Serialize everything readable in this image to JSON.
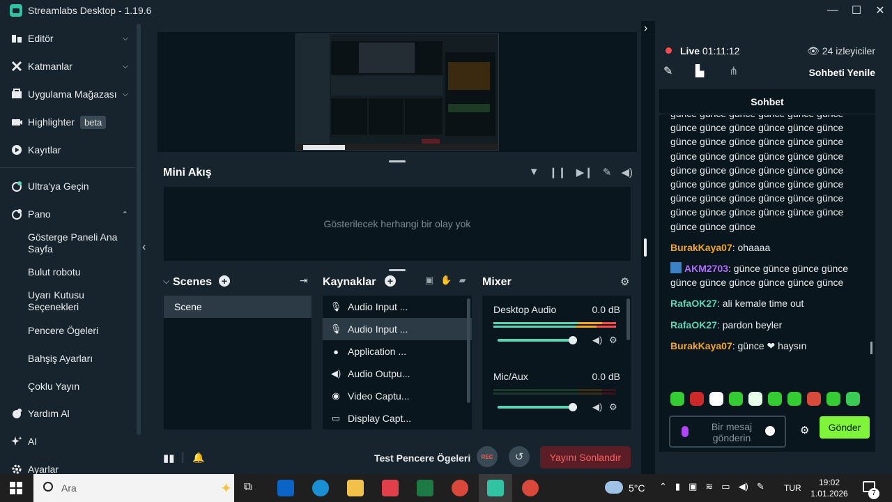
{
  "window": {
    "title": "Streamlabs Desktop - 1.19.6",
    "minimize": "—",
    "maximize": "☐",
    "close": "✕"
  },
  "sidebar": {
    "items": [
      {
        "label": "Editör",
        "icon": "editor-icon",
        "chevron": "⌵"
      },
      {
        "label": "Katmanlar",
        "icon": "layers-icon",
        "chevron": "⌵"
      },
      {
        "label": "Uygulama Mağazası",
        "icon": "store-icon",
        "chevron": "⌵"
      },
      {
        "label": "Highlighter",
        "icon": "highlighter-icon",
        "badge": "beta"
      },
      {
        "label": "Kayıtlar",
        "icon": "recordings-icon"
      },
      {
        "label": "Ultra'ya Geçin",
        "icon": "ultra-icon"
      },
      {
        "label": "Pano",
        "icon": "dashboard-icon",
        "chevron": "⌃"
      },
      {
        "label": "Yardım Al",
        "icon": "help-icon"
      },
      {
        "label": "AI",
        "icon": "ai-icon"
      },
      {
        "label": "Ayarlar",
        "icon": "settings-icon"
      }
    ],
    "subitems": [
      "Gösterge Paneli Ana Sayfa",
      "Bulut robotu",
      "Uyarı Kutusu Seçenekleri",
      "Pencere Ögeleri",
      "Bahşiş Ayarları",
      "Çoklu Yayın"
    ]
  },
  "mini_feed": {
    "title": "Mini Akış",
    "empty_text": "Gösterilecek herhangi bir olay yok"
  },
  "scenes": {
    "title": "Scenes",
    "items": [
      "Scene"
    ]
  },
  "sources": {
    "title": "Kaynaklar",
    "items": [
      {
        "label": "Audio Input ...",
        "icon": "microphone-icon"
      },
      {
        "label": "Audio Input ...",
        "icon": "microphone-icon"
      },
      {
        "label": "Application ...",
        "icon": "user-icon"
      },
      {
        "label": "Audio Outpu...",
        "icon": "speaker-icon"
      },
      {
        "label": "Video Captu...",
        "icon": "webcam-icon"
      },
      {
        "label": "Display Capt...",
        "icon": "monitor-icon"
      }
    ]
  },
  "mixer": {
    "title": "Mixer",
    "channels": [
      {
        "name": "Desktop Audio",
        "db": "0.0 dB",
        "volume": 1.0
      },
      {
        "name": "Mic/Aux",
        "db": "0.0 dB",
        "volume": 1.0
      }
    ]
  },
  "footer": {
    "test_widgets": "Test Pencere Ögeleri",
    "rec": "REC",
    "end_stream": "Yayını Sonlandır"
  },
  "stream": {
    "live_label": "Live",
    "live_time": "01:11:12",
    "viewers": "24 izleyiciler",
    "refresh_chat": "Sohbeti Yenile"
  },
  "chat": {
    "title": "Sohbet",
    "spam_text": "günce günce günce günce günce günce günce günce günce günce günce günce günce günce günce günce günce günce günce günce günce günce günce günce günce günce günce günce günce günce günce günce günce günce günce günce günce günce günce günce günce günce günce günce günce günce günce günce günce günce günce",
    "messages": [
      {
        "user": "BurakKaya07",
        "color": "#f5a623",
        "text": ": ohaaaa"
      },
      {
        "user": "AKM2703",
        "color": "#b26bff",
        "text": ": günce günce günce günce günce günce günce günce günce günce"
      },
      {
        "user": "RafaOK27",
        "color": "#5fd6b3",
        "text": ": ali kemale time out"
      },
      {
        "user": "RafaOK27",
        "color": "#5fd6b3",
        "text": ": pardon beyler"
      },
      {
        "user": "BurakKaya07",
        "color": "#f5a623",
        "text": ": günce ❤ haysın"
      }
    ],
    "input_placeholder": "Bir mesaj gönderin",
    "send_label": "Gönder"
  },
  "taskbar": {
    "search_placeholder": "Ara",
    "weather": "5°C",
    "language": "TUR",
    "time": "19:02",
    "date": "1.01.2026",
    "notifications": "7"
  }
}
